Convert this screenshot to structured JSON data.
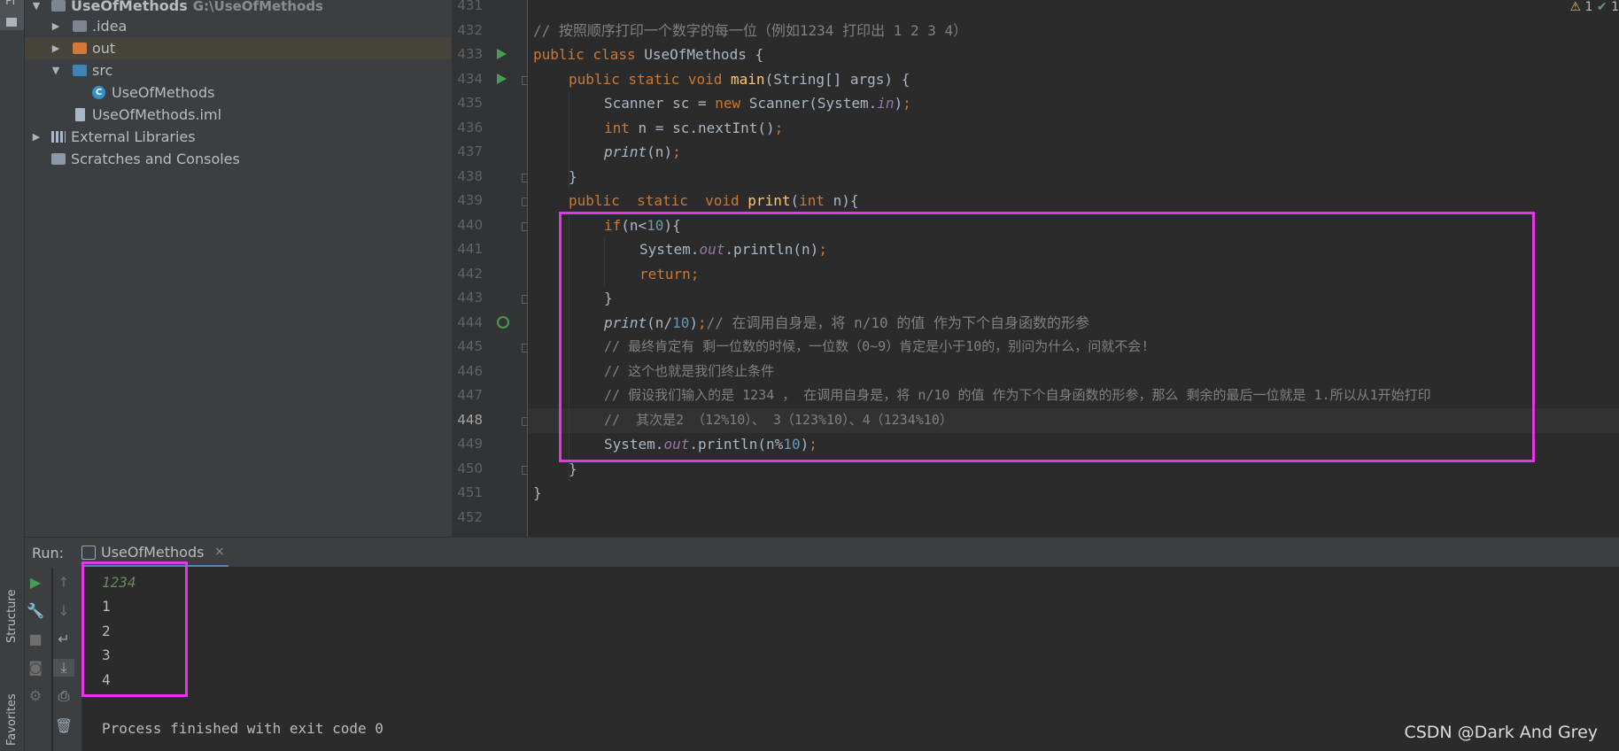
{
  "sidebar": {
    "project_label": "Pr",
    "structure_label": "Structure",
    "favorites_label": "Favorites"
  },
  "project_tree": {
    "items": [
      {
        "label": "UseOfMethods",
        "path": "G:\\UseOfMethods",
        "icon": "module-icon",
        "expanded": true
      },
      {
        "label": ".idea",
        "icon": "folder-icon",
        "expanded": false
      },
      {
        "label": "out",
        "icon": "folder-orange-icon",
        "expanded": false,
        "selected": true
      },
      {
        "label": "src",
        "icon": "folder-source-icon",
        "expanded": true
      },
      {
        "label": "UseOfMethods",
        "icon": "java-class-icon"
      },
      {
        "label": "UseOfMethods.iml",
        "icon": "iml-file-icon"
      },
      {
        "label": "External Libraries",
        "icon": "libraries-icon",
        "expanded": false
      },
      {
        "label": "Scratches and Consoles",
        "icon": "scratches-icon"
      }
    ],
    "class_icon_letter": "C"
  },
  "editor": {
    "line_numbers": [
      "431",
      "432",
      "433",
      "434",
      "435",
      "436",
      "437",
      "438",
      "439",
      "440",
      "441",
      "442",
      "443",
      "444",
      "445",
      "446",
      "447",
      "448",
      "449",
      "450",
      "451",
      "452"
    ],
    "current_line": "448",
    "status": {
      "warnings": "1",
      "ok": "1"
    },
    "code": {
      "l432": "// 按照顺序打印一个数字的每一位（例如1234 打印出 1 2 3 4）",
      "l433_kw": "public class ",
      "l433_name": "UseOfMethods {",
      "l434_kw": "public static void ",
      "l434_fn": "main",
      "l434_rest": "(String[] args) {",
      "l435_a": "Scanner sc = ",
      "l435_kw": "new ",
      "l435_b": "Scanner(System.",
      "l435_fld": "in",
      "l435_c": ")",
      "l435_semi": ";",
      "l436_kw": "int ",
      "l436_rest": "n = sc.nextInt()",
      "l436_semi": ";",
      "l437_st": "print",
      "l437_rest": "(n)",
      "l437_semi": ";",
      "l438": "}",
      "l439_kw": "public  static  void ",
      "l439_fn": "print",
      "l439_a": "(",
      "l439_kw2": "int ",
      "l439_b": "n){",
      "l440_kw": "if",
      "l440_a": "(n<",
      "l440_num": "10",
      "l440_b": "){",
      "l441_a": "System.",
      "l441_fld": "out",
      "l441_b": ".println(n)",
      "l441_semi": ";",
      "l442_kw": "return;",
      "l443": "}",
      "l444_st": "print",
      "l444_a": "(n/",
      "l444_num": "10",
      "l444_b": ")",
      "l444_semi": ";",
      "l444_cm": "// 在调用自身是，将 n/10 的值 作为下个自身函数的形参",
      "l445_cm": "// 最终肯定有 剩一位数的时候，一位数（0~9）肯定是小于10的，别问为什么，问就不会!",
      "l446_cm": "// 这个也就是我们终止条件",
      "l447_cm": "// 假设我们输入的是 1234 ， 在调用自身是，将 n/10 的值 作为下个自身函数的形参，那么 剩余的最后一位就是 1.所以从1开始打印",
      "l448_cm": "//  其次是2 （12%10）、 3（123%10）、4（1234%10）",
      "l449_a": "System.",
      "l449_fld": "out",
      "l449_b": ".println(n%",
      "l449_num": "10",
      "l449_c": ")",
      "l449_semi": ";",
      "l450": "}",
      "l451": "}"
    }
  },
  "run_panel": {
    "title": "Run:",
    "tab_label": "UseOfMethods",
    "close_glyph": "×",
    "output": [
      "1234",
      "1",
      "2",
      "3",
      "4"
    ],
    "exit_message": "Process finished with exit code 0"
  },
  "watermark": "CSDN @Dark And Grey"
}
